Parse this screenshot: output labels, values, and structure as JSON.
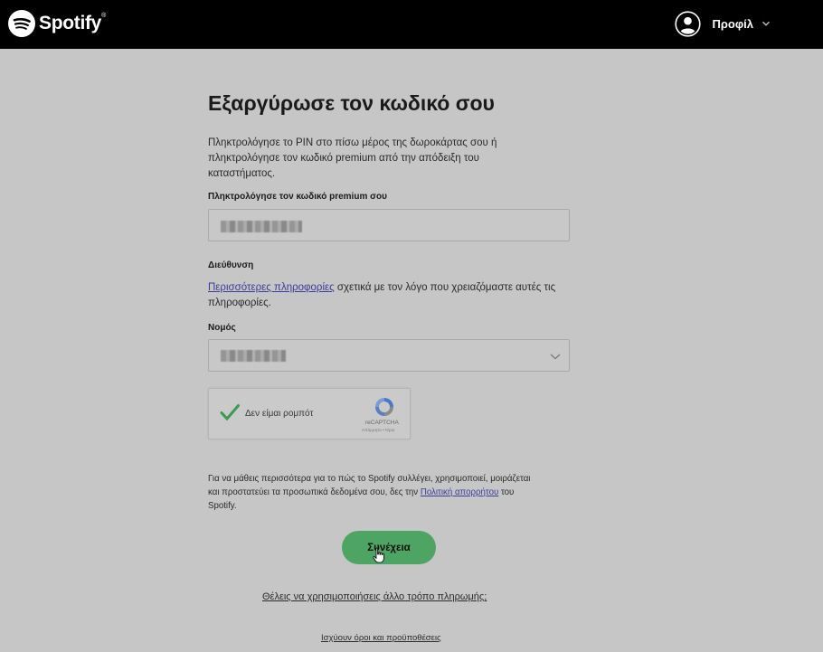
{
  "header": {
    "logo_text": "Spotify",
    "logo_mark": "®",
    "profile_label": "Προφίλ"
  },
  "form": {
    "title": "Εξαργύρωσε τον κωδικό σου",
    "intro": "Πληκτρολόγησε το PIN στο πίσω μέρος της δωροκάρτας σου ή πληκτρολόγησε τον κωδικό premium από την απόδειξη του καταστήματος.",
    "code_label": "Πληκτρολόγησε τον κωδικό premium σου",
    "address_label": "Διεύθυνση",
    "more_info_link": "Περισσότερες πληροφορίες",
    "more_info_text": " σχετικά με τον λόγο που χρειαζόμαστε αυτές τις πληροφορίες.",
    "state_label": "Νομός"
  },
  "captcha": {
    "text": "Δεν είμαι ρομπότ",
    "brand": "reCAPTCHA",
    "terms": "Απόρρητο • Όροι",
    "checked": true
  },
  "privacy": {
    "text_before": "Για να μάθεις περισσότερα για το πώς το Spotify συλλέγει, χρησιμοποιεί, μοιράζεται και προστατεύει τα προσωπικά δεδομένα σου, δες την ",
    "link": "Πολιτική απορρήτου",
    "text_after": " του Spotify."
  },
  "actions": {
    "continue_label": "Συνέχεια",
    "other_payment_link": "Θέλεις να χρησιμοποιήσεις άλλο τρόπο πληρωμής;",
    "terms_link": "Ισχύουν όροι και προϋποθέσεις"
  },
  "colors": {
    "topbar": "#000000",
    "page_bg": "#c6c6c6",
    "button": "#4ea563",
    "link": "#3b3b9c"
  },
  "icons": {
    "logo": "spotify-logo-icon",
    "avatar": "user-avatar-icon",
    "profile_chevron": "chevron-down-icon",
    "select_chevron": "chevron-down-icon",
    "captcha_check": "checkmark-icon",
    "captcha_logo": "recaptcha-logo-icon",
    "cursor": "hand-pointer-icon"
  }
}
